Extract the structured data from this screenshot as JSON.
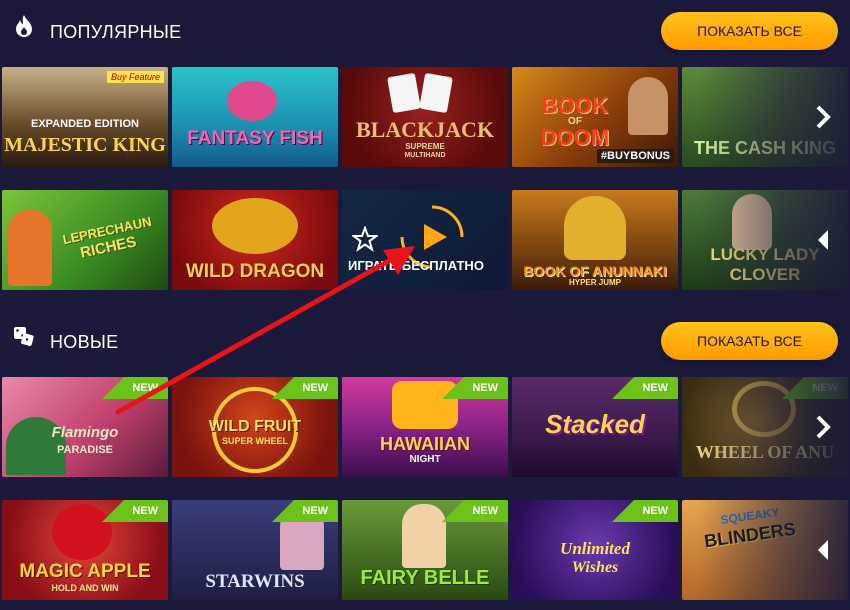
{
  "popular": {
    "title": "ПОПУЛЯРНЫЕ",
    "show_all": "ПОКАЗАТЬ ВСЕ",
    "icon": "fire-icon",
    "row1": [
      {
        "name": "Majestic King",
        "line1": "EXPANDED EDITION",
        "line2": "MAJESTIC KING",
        "extra": "Buy Feature",
        "bg": "#3a2a1c"
      },
      {
        "name": "Fantasy Fish",
        "line1": "FANTASY FISH",
        "bg": "#1fa6b8"
      },
      {
        "name": "Blackjack",
        "line1": "BLACKJACK",
        "line2": "SUPREME",
        "line3": "MULTIHAND",
        "bg": "#6e1414"
      },
      {
        "name": "Book of Doom",
        "line1": "BOOK",
        "line2": "OF",
        "line3": "DOOM",
        "extra": "#BUYBONUS",
        "bg": "#5a2e08"
      },
      {
        "name": "Cash King",
        "line1": "THE CASH KING",
        "bg": "#244c2a"
      }
    ],
    "row2": [
      {
        "name": "Leprechaun Riches",
        "line1": "LEPRECHAUN",
        "line2": "RICHES",
        "bg": "#2f6a1e"
      },
      {
        "name": "Wild Dragon",
        "line1": "WILD DRAGON",
        "bg": "#8a0f12"
      },
      {
        "name": "Hover tile",
        "play_label": "ИГРАТЬ БЕСПЛАТНО",
        "bg": "#1f3f5c"
      },
      {
        "name": "Book of Anunnaki",
        "line1": "BOOK OF ANUNNAKI",
        "line2": "HYPER JUMP",
        "bg": "#6a3a0e"
      },
      {
        "name": "Lucky Lady Clover",
        "line1": "LUCKY LADY",
        "line2": "CLOVER",
        "bg": "#2a4a22"
      }
    ]
  },
  "new": {
    "title": "НОВЫЕ",
    "show_all": "ПОКАЗАТЬ ВСЕ",
    "icon": "dice-icon",
    "badge": "NEW",
    "row1": [
      {
        "name": "Flamingo Paradise",
        "line1": "Flamingo",
        "line2": "PARADISE",
        "bg": "#c2416e"
      },
      {
        "name": "Wild Fruit Super Wheel",
        "line1": "WILD FRUIT",
        "line2": "SUPER WHEEL",
        "bg": "#7a120e"
      },
      {
        "name": "Hawaiian Night",
        "line1": "HAWAIIAN",
        "line2": "NIGHT",
        "bg": "#8a2288"
      },
      {
        "name": "Stacked",
        "line1": "Stacked",
        "bg": "#4c1c6a"
      },
      {
        "name": "Wheel of Anubis",
        "line1": "WHEEL OF ANU",
        "bg": "#3a2c12"
      }
    ],
    "row2": [
      {
        "name": "Magic Apple",
        "line1": "MAGIC APPLE",
        "line2": "HOLD AND WIN",
        "bg": "#b61b24"
      },
      {
        "name": "Starwins",
        "line1": "STARWINS",
        "bg": "#2a2e5a"
      },
      {
        "name": "Fairy Belle",
        "line1": "FAIRY BELLE",
        "bg": "#3c6a1e"
      },
      {
        "name": "Unlimited Wishes",
        "line1": "Unlimited",
        "line2": "Wishes",
        "bg": "#3a1e7a"
      },
      {
        "name": "Squeaky Blinders",
        "line1": "SQUEAKY",
        "line2": "BLINDERS",
        "bg": "#c4752a"
      }
    ]
  },
  "colors": {
    "background": "#1b1a3a",
    "button": "#ffb00f",
    "badge": "#6cc218",
    "annotation_arrow": "#e8141a"
  }
}
